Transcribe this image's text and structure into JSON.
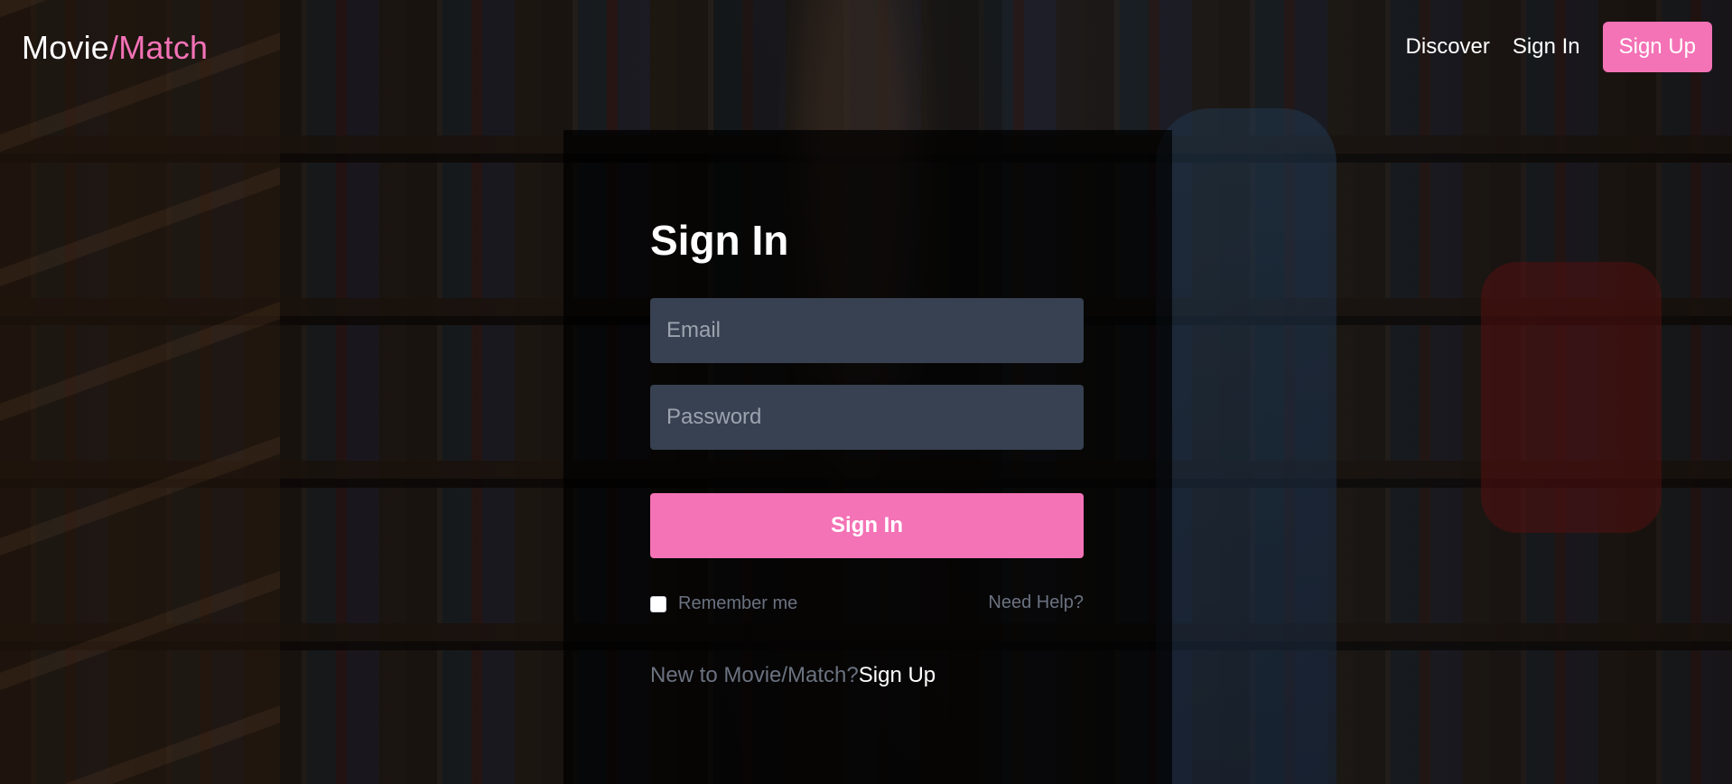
{
  "header": {
    "logo_main": "Movie",
    "logo_accent": "/Match",
    "nav": {
      "discover": "Discover",
      "sign_in": "Sign In",
      "sign_up": "Sign Up"
    }
  },
  "form": {
    "title": "Sign In",
    "email_placeholder": "Email",
    "password_placeholder": "Password",
    "submit_label": "Sign In",
    "remember_label": "Remember me",
    "remember_checked": false,
    "help_label": "Need Help?",
    "signup_prompt": "New to Movie/Match?",
    "signup_link": "Sign Up"
  },
  "colors": {
    "accent": "#f472b6",
    "input_bg": "#374151",
    "muted_text": "#6b7280"
  }
}
